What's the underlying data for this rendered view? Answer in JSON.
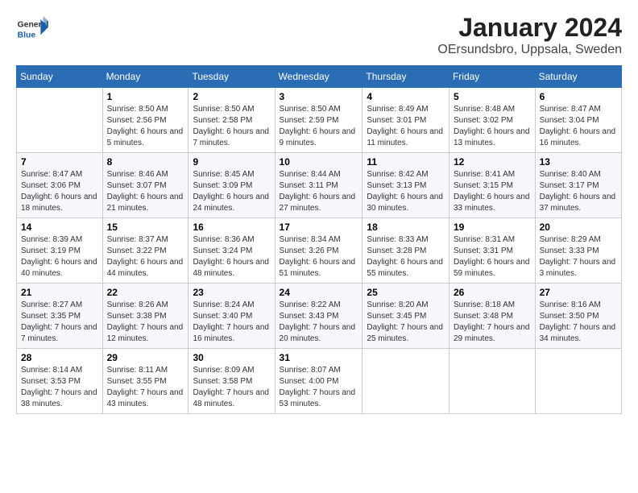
{
  "header": {
    "logo_general": "General",
    "logo_blue": "Blue",
    "month_title": "January 2024",
    "location": "OErsundsbro, Uppsala, Sweden"
  },
  "weekdays": [
    "Sunday",
    "Monday",
    "Tuesday",
    "Wednesday",
    "Thursday",
    "Friday",
    "Saturday"
  ],
  "weeks": [
    [
      {
        "day": "",
        "sunrise": "",
        "sunset": "",
        "daylight": ""
      },
      {
        "day": "1",
        "sunrise": "Sunrise: 8:50 AM",
        "sunset": "Sunset: 2:56 PM",
        "daylight": "Daylight: 6 hours and 5 minutes."
      },
      {
        "day": "2",
        "sunrise": "Sunrise: 8:50 AM",
        "sunset": "Sunset: 2:58 PM",
        "daylight": "Daylight: 6 hours and 7 minutes."
      },
      {
        "day": "3",
        "sunrise": "Sunrise: 8:50 AM",
        "sunset": "Sunset: 2:59 PM",
        "daylight": "Daylight: 6 hours and 9 minutes."
      },
      {
        "day": "4",
        "sunrise": "Sunrise: 8:49 AM",
        "sunset": "Sunset: 3:01 PM",
        "daylight": "Daylight: 6 hours and 11 minutes."
      },
      {
        "day": "5",
        "sunrise": "Sunrise: 8:48 AM",
        "sunset": "Sunset: 3:02 PM",
        "daylight": "Daylight: 6 hours and 13 minutes."
      },
      {
        "day": "6",
        "sunrise": "Sunrise: 8:47 AM",
        "sunset": "Sunset: 3:04 PM",
        "daylight": "Daylight: 6 hours and 16 minutes."
      }
    ],
    [
      {
        "day": "7",
        "sunrise": "Sunrise: 8:47 AM",
        "sunset": "Sunset: 3:06 PM",
        "daylight": "Daylight: 6 hours and 18 minutes."
      },
      {
        "day": "8",
        "sunrise": "Sunrise: 8:46 AM",
        "sunset": "Sunset: 3:07 PM",
        "daylight": "Daylight: 6 hours and 21 minutes."
      },
      {
        "day": "9",
        "sunrise": "Sunrise: 8:45 AM",
        "sunset": "Sunset: 3:09 PM",
        "daylight": "Daylight: 6 hours and 24 minutes."
      },
      {
        "day": "10",
        "sunrise": "Sunrise: 8:44 AM",
        "sunset": "Sunset: 3:11 PM",
        "daylight": "Daylight: 6 hours and 27 minutes."
      },
      {
        "day": "11",
        "sunrise": "Sunrise: 8:42 AM",
        "sunset": "Sunset: 3:13 PM",
        "daylight": "Daylight: 6 hours and 30 minutes."
      },
      {
        "day": "12",
        "sunrise": "Sunrise: 8:41 AM",
        "sunset": "Sunset: 3:15 PM",
        "daylight": "Daylight: 6 hours and 33 minutes."
      },
      {
        "day": "13",
        "sunrise": "Sunrise: 8:40 AM",
        "sunset": "Sunset: 3:17 PM",
        "daylight": "Daylight: 6 hours and 37 minutes."
      }
    ],
    [
      {
        "day": "14",
        "sunrise": "Sunrise: 8:39 AM",
        "sunset": "Sunset: 3:19 PM",
        "daylight": "Daylight: 6 hours and 40 minutes."
      },
      {
        "day": "15",
        "sunrise": "Sunrise: 8:37 AM",
        "sunset": "Sunset: 3:22 PM",
        "daylight": "Daylight: 6 hours and 44 minutes."
      },
      {
        "day": "16",
        "sunrise": "Sunrise: 8:36 AM",
        "sunset": "Sunset: 3:24 PM",
        "daylight": "Daylight: 6 hours and 48 minutes."
      },
      {
        "day": "17",
        "sunrise": "Sunrise: 8:34 AM",
        "sunset": "Sunset: 3:26 PM",
        "daylight": "Daylight: 6 hours and 51 minutes."
      },
      {
        "day": "18",
        "sunrise": "Sunrise: 8:33 AM",
        "sunset": "Sunset: 3:28 PM",
        "daylight": "Daylight: 6 hours and 55 minutes."
      },
      {
        "day": "19",
        "sunrise": "Sunrise: 8:31 AM",
        "sunset": "Sunset: 3:31 PM",
        "daylight": "Daylight: 6 hours and 59 minutes."
      },
      {
        "day": "20",
        "sunrise": "Sunrise: 8:29 AM",
        "sunset": "Sunset: 3:33 PM",
        "daylight": "Daylight: 7 hours and 3 minutes."
      }
    ],
    [
      {
        "day": "21",
        "sunrise": "Sunrise: 8:27 AM",
        "sunset": "Sunset: 3:35 PM",
        "daylight": "Daylight: 7 hours and 7 minutes."
      },
      {
        "day": "22",
        "sunrise": "Sunrise: 8:26 AM",
        "sunset": "Sunset: 3:38 PM",
        "daylight": "Daylight: 7 hours and 12 minutes."
      },
      {
        "day": "23",
        "sunrise": "Sunrise: 8:24 AM",
        "sunset": "Sunset: 3:40 PM",
        "daylight": "Daylight: 7 hours and 16 minutes."
      },
      {
        "day": "24",
        "sunrise": "Sunrise: 8:22 AM",
        "sunset": "Sunset: 3:43 PM",
        "daylight": "Daylight: 7 hours and 20 minutes."
      },
      {
        "day": "25",
        "sunrise": "Sunrise: 8:20 AM",
        "sunset": "Sunset: 3:45 PM",
        "daylight": "Daylight: 7 hours and 25 minutes."
      },
      {
        "day": "26",
        "sunrise": "Sunrise: 8:18 AM",
        "sunset": "Sunset: 3:48 PM",
        "daylight": "Daylight: 7 hours and 29 minutes."
      },
      {
        "day": "27",
        "sunrise": "Sunrise: 8:16 AM",
        "sunset": "Sunset: 3:50 PM",
        "daylight": "Daylight: 7 hours and 34 minutes."
      }
    ],
    [
      {
        "day": "28",
        "sunrise": "Sunrise: 8:14 AM",
        "sunset": "Sunset: 3:53 PM",
        "daylight": "Daylight: 7 hours and 38 minutes."
      },
      {
        "day": "29",
        "sunrise": "Sunrise: 8:11 AM",
        "sunset": "Sunset: 3:55 PM",
        "daylight": "Daylight: 7 hours and 43 minutes."
      },
      {
        "day": "30",
        "sunrise": "Sunrise: 8:09 AM",
        "sunset": "Sunset: 3:58 PM",
        "daylight": "Daylight: 7 hours and 48 minutes."
      },
      {
        "day": "31",
        "sunrise": "Sunrise: 8:07 AM",
        "sunset": "Sunset: 4:00 PM",
        "daylight": "Daylight: 7 hours and 53 minutes."
      },
      {
        "day": "",
        "sunrise": "",
        "sunset": "",
        "daylight": ""
      },
      {
        "day": "",
        "sunrise": "",
        "sunset": "",
        "daylight": ""
      },
      {
        "day": "",
        "sunrise": "",
        "sunset": "",
        "daylight": ""
      }
    ]
  ]
}
